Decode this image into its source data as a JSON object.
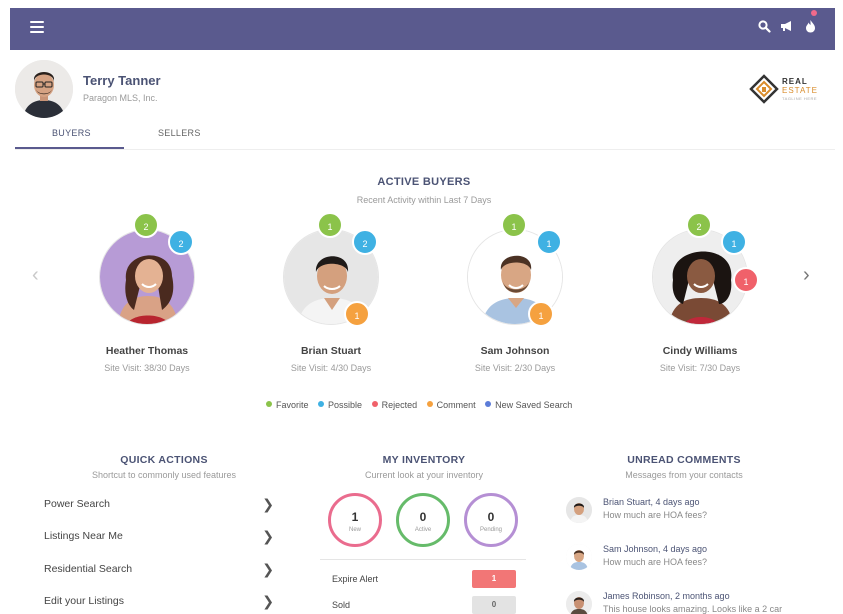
{
  "topbar": {
    "background": "#5a5a8e",
    "icons": [
      "menu-icon",
      "search-icon",
      "megaphone-icon",
      "notification-icon"
    ]
  },
  "profile": {
    "name": "Terry Tanner",
    "org": "Paragon MLS, Inc."
  },
  "brand": {
    "line1": "REAL",
    "line2": "ESTATE",
    "line3": "TAGLINE HERE"
  },
  "tabs": [
    {
      "label": "BUYERS",
      "active": true
    },
    {
      "label": "SELLERS",
      "active": false
    }
  ],
  "active_buyers": {
    "title": "ACTIVE BUYERS",
    "subtitle": "Recent Activity within Last 7 Days",
    "buyers": [
      {
        "name": "Heather Thomas",
        "visits": "Site Visit: 38/30 Days",
        "favorite": "2",
        "possible": "2",
        "comment": null,
        "rejected": null
      },
      {
        "name": "Brian Stuart",
        "visits": "Site Visit: 4/30 Days",
        "favorite": "1",
        "possible": "2",
        "comment": "1",
        "rejected": null
      },
      {
        "name": "Sam Johnson",
        "visits": "Site Visit: 2/30 Days",
        "favorite": "1",
        "possible": "1",
        "comment": "1",
        "rejected": null
      },
      {
        "name": "Cindy Williams",
        "visits": "Site Visit: 7/30 Days",
        "favorite": "2",
        "possible": "1",
        "comment": null,
        "rejected": "1"
      }
    ]
  },
  "legend": [
    {
      "label": "Favorite",
      "color": "#8bc34a"
    },
    {
      "label": "Possible",
      "color": "#3fb1e3"
    },
    {
      "label": "Rejected",
      "color": "#f0616a"
    },
    {
      "label": "Comment",
      "color": "#f5a13f"
    },
    {
      "label": "New Saved Search",
      "color": "#5c7cd8"
    }
  ],
  "quick_actions": {
    "title": "QUICK ACTIONS",
    "subtitle": "Shortcut to commonly used features",
    "items": [
      "Power Search",
      "Listings Near Me",
      "Residential Search",
      "Edit your Listings"
    ]
  },
  "inventory": {
    "title": "MY INVENTORY",
    "subtitle": "Current look at your inventory",
    "rings": [
      {
        "value": "1",
        "label": "New"
      },
      {
        "value": "0",
        "label": "Active"
      },
      {
        "value": "0",
        "label": "Pending"
      }
    ],
    "rows": [
      {
        "label": "Expire Alert",
        "value": "1"
      },
      {
        "label": "Sold",
        "value": "0"
      }
    ]
  },
  "comments": {
    "title": "UNREAD COMMENTS",
    "subtitle": "Messages from your contacts",
    "items": [
      {
        "who": "Brian Stuart, 4 days ago",
        "msg": "How much are HOA fees?"
      },
      {
        "who": "Sam Johnson, 4 days ago",
        "msg": "How much are HOA fees?"
      },
      {
        "who": "James Robinson, 2 months ago",
        "msg": "This house looks amazing. Looks like a 2 car"
      }
    ]
  }
}
